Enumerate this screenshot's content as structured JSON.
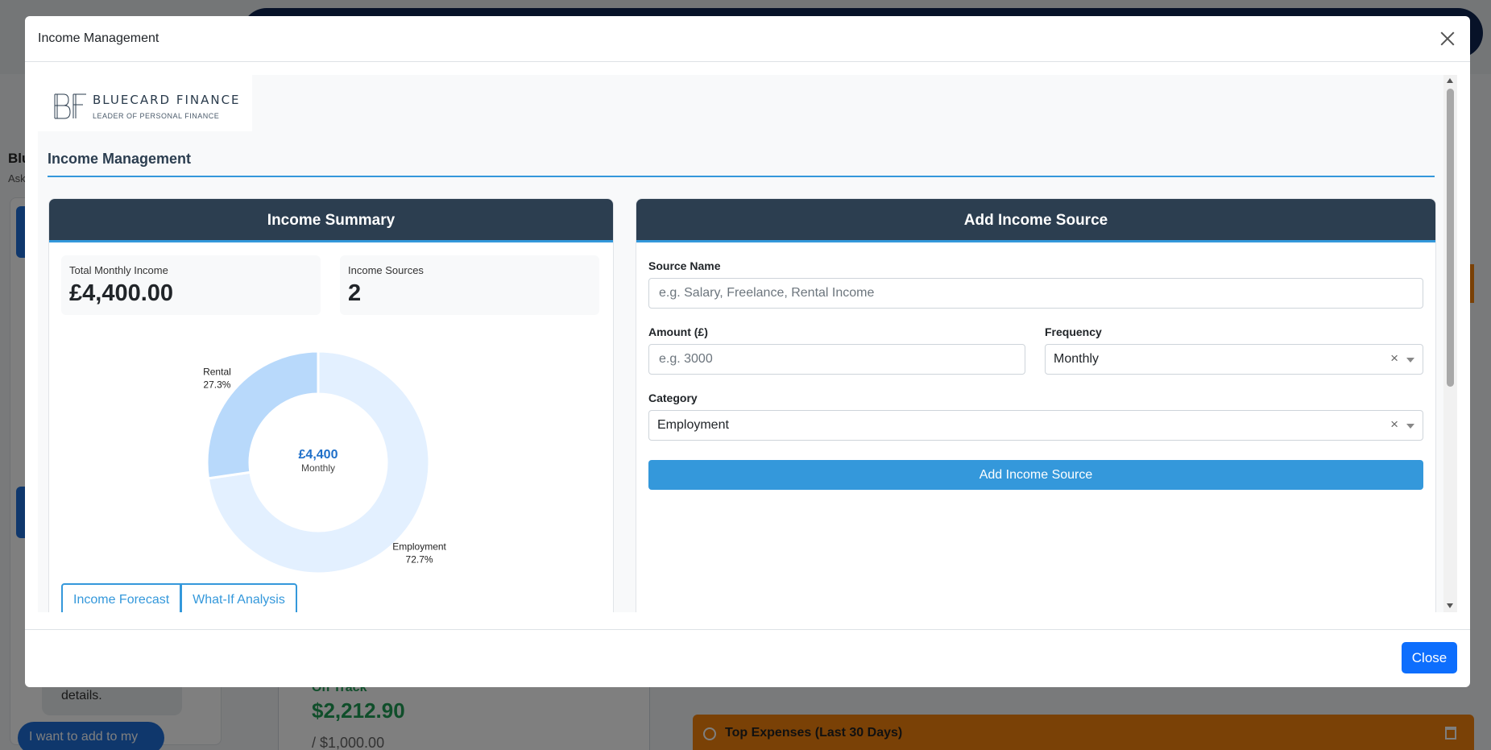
{
  "background": {
    "left_title": "Blu",
    "left_sub": "Ask",
    "bubble_text": "details.",
    "chip_text": "I want to add to my",
    "on_track": "On Track",
    "amount": "$2,212.90",
    "limit": "/ $1,000.00",
    "top_expenses": "Top Expenses (Last 30 Days)"
  },
  "modal": {
    "title": "Income Management",
    "close_label": "Close",
    "logo": {
      "initials": "BF",
      "name": "BLUECARD FINANCE",
      "tagline": "LEADER OF PERSONAL FINANCE"
    },
    "section_title": "Income Management",
    "summary": {
      "header": "Income Summary",
      "total_label": "Total Monthly Income",
      "total_value": "£4,400.00",
      "sources_label": "Income Sources",
      "sources_value": "2",
      "center_value": "£4,400",
      "center_label": "Monthly",
      "tabs": [
        "Income Forecast",
        "What-If Analysis"
      ]
    },
    "form": {
      "header": "Add Income Source",
      "source_label": "Source Name",
      "source_placeholder": "e.g. Salary, Freelance, Rental Income",
      "amount_label": "Amount (£)",
      "amount_placeholder": "e.g. 3000",
      "frequency_label": "Frequency",
      "frequency_value": "Monthly",
      "category_label": "Category",
      "category_value": "Employment",
      "clear_glyph": "×",
      "submit_label": "Add Income Source"
    }
  },
  "chart_data": {
    "type": "pie",
    "donut": true,
    "categories": [
      "Employment",
      "Rental"
    ],
    "values": [
      72.7,
      27.3
    ],
    "value_labels": [
      "72.7%",
      "27.3%"
    ],
    "colors": [
      "#e3f0ff",
      "#b8d9fb"
    ]
  }
}
